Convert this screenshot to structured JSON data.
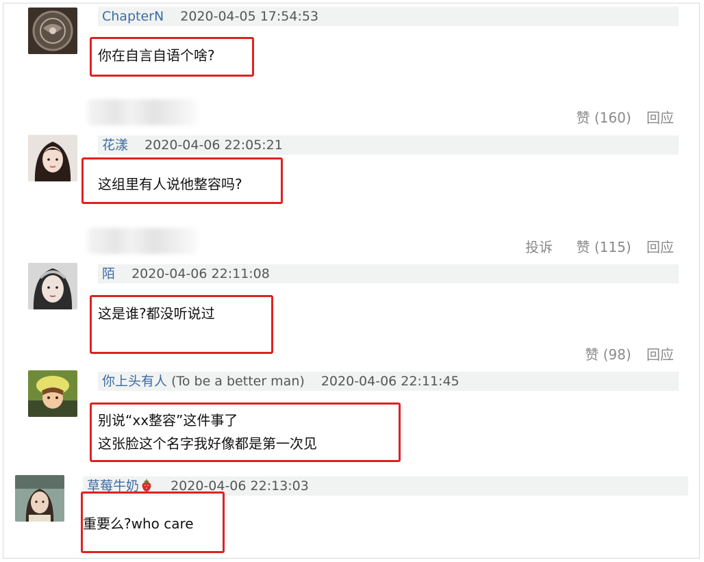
{
  "comments": [
    {
      "user": "ChapterN",
      "nick": "",
      "time": "2020-04-05 17:54:53",
      "lines": [
        "你在自言自语个啥?"
      ],
      "actions": {
        "report": "",
        "like": "赞 (160)",
        "reply": "回应"
      }
    },
    {
      "user": "花漾",
      "nick": "",
      "time": "2020-04-06 22:05:21",
      "lines": [
        "这组里有人说他整容吗?"
      ],
      "actions": {
        "report": "投诉",
        "like": "赞 (115)",
        "reply": "回应"
      }
    },
    {
      "user": "陌",
      "nick": "",
      "time": "2020-04-06 22:11:08",
      "lines": [
        "这是谁?都没听说过"
      ],
      "actions": {
        "report": "",
        "like": "赞 (98)",
        "reply": "回应"
      }
    },
    {
      "user": "你上头有人",
      "nick": "(To be a better man)",
      "time": "2020-04-06 22:11:45",
      "lines": [
        "别说“xx整容”这件事了",
        "这张脸这个名字我好像都是第一次见"
      ]
    },
    {
      "user": "草莓牛奶",
      "nick": "",
      "time": "2020-04-06 22:13:03",
      "lines": [
        "重要么?who care"
      ]
    }
  ],
  "colors": {
    "highlight_box": "#e02020",
    "username": "#3d6aa3",
    "header_bg": "#f0f3f2"
  },
  "icons": [
    "strawberry-icon"
  ]
}
